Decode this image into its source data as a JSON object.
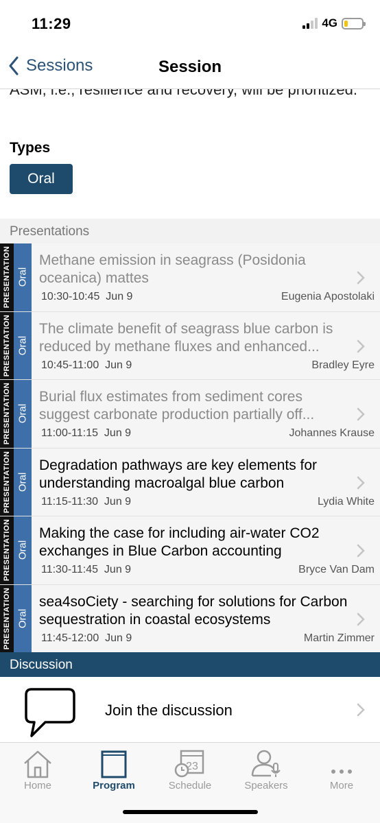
{
  "status_bar": {
    "time": "11:29",
    "network": "4G"
  },
  "nav": {
    "back_label": "Sessions",
    "title": "Session"
  },
  "description_fragment": "ASM, i.e., resilience and recovery, will be prioritized.",
  "types": {
    "heading": "Types",
    "badge": "Oral"
  },
  "presentations": {
    "header": "Presentations",
    "items": [
      {
        "kind": "PRESENTATION",
        "type": "Oral",
        "title": "Methane emission in seagrass (Posidonia oceanica) mattes",
        "time": "10:30-10:45",
        "date": "Jun 9",
        "speaker": "Eugenia Apostolaki"
      },
      {
        "kind": "PRESENTATION",
        "type": "Oral",
        "title": "The climate benefit of seagrass blue carbon is reduced by methane fluxes and enhanced...",
        "time": "10:45-11:00",
        "date": "Jun 9",
        "speaker": "Bradley Eyre"
      },
      {
        "kind": "PRESENTATION",
        "type": "Oral",
        "title": "Burial flux estimates from sediment cores suggest carbonate production partially off...",
        "time": "11:00-11:15",
        "date": "Jun 9",
        "speaker": "Johannes Krause"
      },
      {
        "kind": "PRESENTATION",
        "type": "Oral",
        "title": "Degradation pathways are key elements for understanding macroalgal blue carbon",
        "time": "11:15-11:30",
        "date": "Jun 9",
        "speaker": "Lydia White"
      },
      {
        "kind": "PRESENTATION",
        "type": "Oral",
        "title": "Making the case for including air-water CO2 exchanges in Blue Carbon accounting",
        "time": "11:30-11:45",
        "date": "Jun 9",
        "speaker": "Bryce Van Dam"
      },
      {
        "kind": "PRESENTATION",
        "type": "Oral",
        "title": "sea4soCiety - searching for solutions for Carbon sequestration in coastal ecosystems",
        "time": "11:45-12:00",
        "date": "Jun 9",
        "speaker": "Martin Zimmer"
      }
    ]
  },
  "discussion": {
    "header": "Discussion",
    "join_label": "Join the discussion"
  },
  "tabs": [
    {
      "label": "Home",
      "icon": "home-icon"
    },
    {
      "label": "Program",
      "icon": "book-icon",
      "active": true
    },
    {
      "label": "Schedule",
      "icon": "calendar-icon",
      "calendar_day": "23"
    },
    {
      "label": "Speakers",
      "icon": "speaker-icon"
    },
    {
      "label": "More",
      "icon": "more-icon"
    }
  ],
  "colors": {
    "accent": "#1e4a6c",
    "type_strip": "#3e6fa8",
    "battery": "#f1c40f"
  }
}
